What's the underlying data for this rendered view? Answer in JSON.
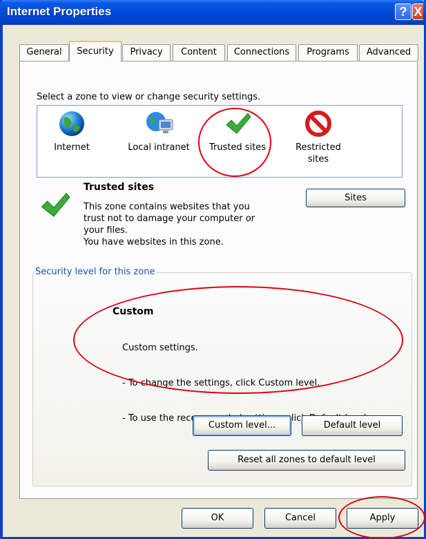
{
  "window": {
    "title": "Internet Properties",
    "help_symbol": "?",
    "close_symbol": "X"
  },
  "tabs": [
    "General",
    "Security",
    "Privacy",
    "Content",
    "Connections",
    "Programs",
    "Advanced"
  ],
  "active_tab": "Security",
  "zones": {
    "prompt": "Select a zone to view or change security settings.",
    "items": [
      {
        "label": "Internet",
        "icon": "globe-icon"
      },
      {
        "label": "Local intranet",
        "icon": "network-globe-icon"
      },
      {
        "label": "Trusted sites",
        "icon": "checkmark-icon"
      },
      {
        "label_line1": "Restricted",
        "label_line2": "sites",
        "icon": "prohibited-icon"
      }
    ],
    "selected": "Trusted sites"
  },
  "detail": {
    "title": "Trusted sites",
    "desc_lines": [
      "This zone contains websites that you",
      "trust not to damage your computer or",
      "your files.",
      "You have websites in this zone."
    ],
    "sites_button": "Sites"
  },
  "security_level": {
    "group_title": "Security level for this zone",
    "title": "Custom",
    "lines": [
      "Custom settings.",
      "- To change the settings, click Custom level.",
      "- To use the recommended settings, click Default level."
    ],
    "custom_level_button": "Custom level...",
    "default_level_button": "Default level",
    "reset_button": "Reset all zones to default level"
  },
  "footer": {
    "ok": "OK",
    "cancel": "Cancel",
    "apply": "Apply"
  },
  "colors": {
    "title_bar": "#0148d6",
    "annotation_red": "#e0000f",
    "dialog_bg": "#ece9d8",
    "tab_highlight": "#ffc83c"
  }
}
